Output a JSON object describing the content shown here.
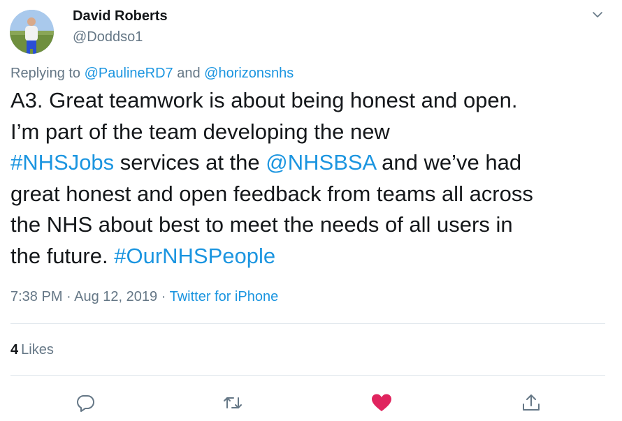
{
  "tweet": {
    "author_name": "David Roberts",
    "author_handle": "@Doddso1",
    "replying_prefix": "Replying to ",
    "replying_users": [
      "@PaulineRD7",
      "@horizonsnhs"
    ],
    "replying_and": " and ",
    "body": {
      "line1": "A3. Great teamwork is about being honest and open.",
      "line2": "I’m part of the team developing the new",
      "line3_tag": "#NHSJobs",
      "line3_mid": " services at the ",
      "line3_mention": "@NHSBSA",
      "line3_end": " and we’ve had",
      "line4": "great honest and open feedback from teams all across",
      "line5": "the NHS about best to meet the needs of all users in",
      "line6_start": "the future. ",
      "line6_tag": "#OurNHSPeople"
    },
    "time": "7:38 PM",
    "sep1": " · ",
    "date": "Aug 12, 2019",
    "sep2": " · ",
    "source": "Twitter for iPhone",
    "likes_count": "4",
    "likes_label": "Likes"
  },
  "colors": {
    "link": "#1b95e0",
    "muted": "#657786",
    "heart": "#e0245e"
  },
  "icons": {
    "menu": "chevron-down-icon",
    "reply": "reply-icon",
    "retweet": "retweet-icon",
    "like": "heart-icon",
    "share": "share-icon"
  }
}
